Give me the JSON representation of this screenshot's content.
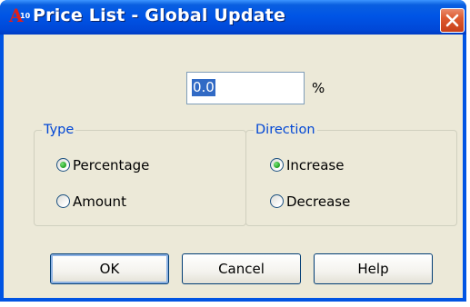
{
  "window": {
    "title": "Price List - Global Update",
    "icon": {
      "name": "app-icon",
      "letter": "A",
      "number": "10"
    },
    "close_icon": "close-icon"
  },
  "value_input": {
    "value": "0.0",
    "unit": "%"
  },
  "type_group": {
    "legend": "Type",
    "options": [
      {
        "label": "Percentage",
        "selected": true
      },
      {
        "label": "Amount",
        "selected": false
      }
    ]
  },
  "direction_group": {
    "legend": "Direction",
    "options": [
      {
        "label": "Increase",
        "selected": true
      },
      {
        "label": "Decrease",
        "selected": false
      }
    ]
  },
  "buttons": {
    "ok": "OK",
    "cancel": "Cancel",
    "help": "Help"
  },
  "colors": {
    "titlebar": "#0054e3",
    "dialog_bg": "#ece9d8",
    "group_legend": "#0046d5",
    "close_button": "#dd5a30",
    "selection": "#316ac5"
  }
}
